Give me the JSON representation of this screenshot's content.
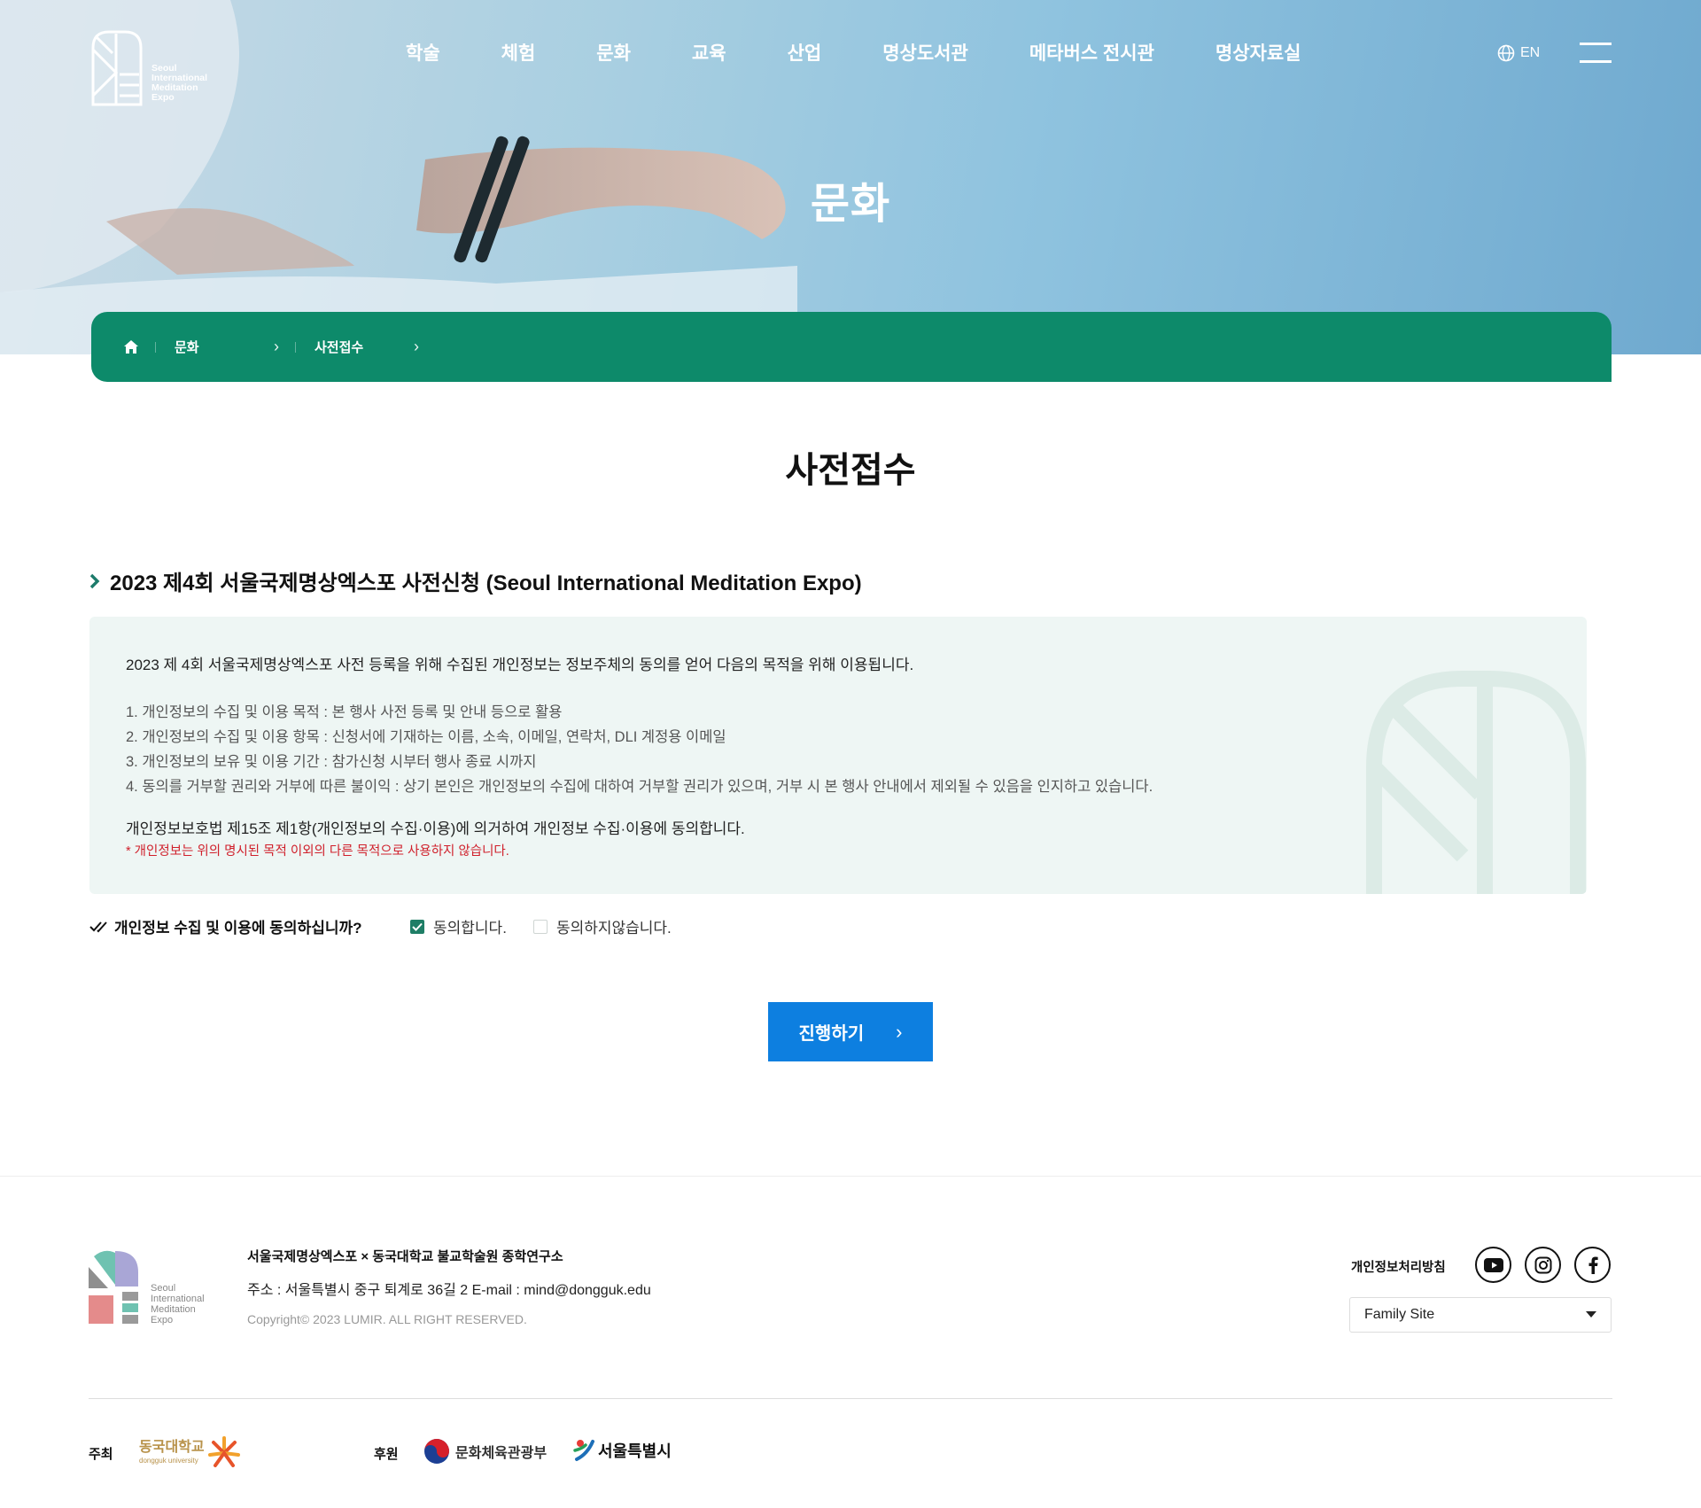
{
  "header": {
    "logo_lines": [
      "Seoul",
      "International",
      "Meditation",
      "Expo"
    ],
    "nav": [
      "학술",
      "체험",
      "문화",
      "교육",
      "산업",
      "명상도서관",
      "메타버스 전시관",
      "명상자료실"
    ],
    "lang": "EN"
  },
  "hero": {
    "title": "문화"
  },
  "breadcrumb": {
    "items": [
      "문화",
      "사전접수"
    ]
  },
  "page": {
    "title": "사전접수"
  },
  "section": {
    "heading": "2023 제4회 서울국제명상엑스포 사전신청 (Seoul International Meditation Expo)",
    "intro": "2023 제 4회 서울국제명상엑스포 사전 등록을 위해 수집된 개인정보는 정보주체의 동의를 얻어 다음의 목적을 위해 이용됩니다.",
    "items": [
      "1. 개인정보의 수집 및 이용 목적 :  본 행사 사전 등록 및 안내 등으로 활용",
      "2. 개인정보의 수집 및 이용 항목 : 신청서에 기재하는 이름, 소속, 이메일, 연락처, DLI 계정용 이메일",
      "3. 개인정보의 보유 및 이용 기간 : 참가신청 시부터 행사 종료 시까지",
      "4. 동의를 거부할 권리와 거부에 따른 불이익 : 상기 본인은 개인정보의 수집에 대하여 거부할 권리가 있으며, 거부 시 본 행사 안내에서 제외될 수 있음을 인지하고 있습니다."
    ],
    "law": "개인정보보호법 제15조 제1항(개인정보의 수집·이용)에 의거하여 개인정보 수집·이용에 동의합니다.",
    "warning": "* 개인정보는 위의 명시된 목적 이외의 다른 목적으로 사용하지 않습니다."
  },
  "consent": {
    "question": "개인정보 수집 및 이용에 동의하십니까?",
    "agree_label": "동의합니다.",
    "disagree_label": "동의하지않습니다.",
    "agree_checked": true
  },
  "proceed_button": {
    "label": "진행하기"
  },
  "footer": {
    "logo_lines": [
      "Seoul",
      "International",
      "Meditation",
      "Expo"
    ],
    "org": "서울국제명상엑스포 × 동국대학교 불교학술원 종학연구소",
    "address": "주소 : 서울특별시 중구 퇴계로 36길 2    E-mail : mind@dongguk.edu",
    "copyright": "Copyright© 2023 LUMIR. ALL RIGHT RESERVED.",
    "privacy": "개인정보처리방침",
    "family_site": "Family Site",
    "host_label": "주최",
    "host_name": "동국대학교",
    "host_sub": "dongguk university",
    "sponsor_label": "후원",
    "sponsor1": "문화체육관광부",
    "sponsor2": "서울특별시"
  },
  "colors": {
    "brand_green": "#0d8a6a",
    "button_blue": "#0d7fe0",
    "warning_red": "#d0202b"
  }
}
